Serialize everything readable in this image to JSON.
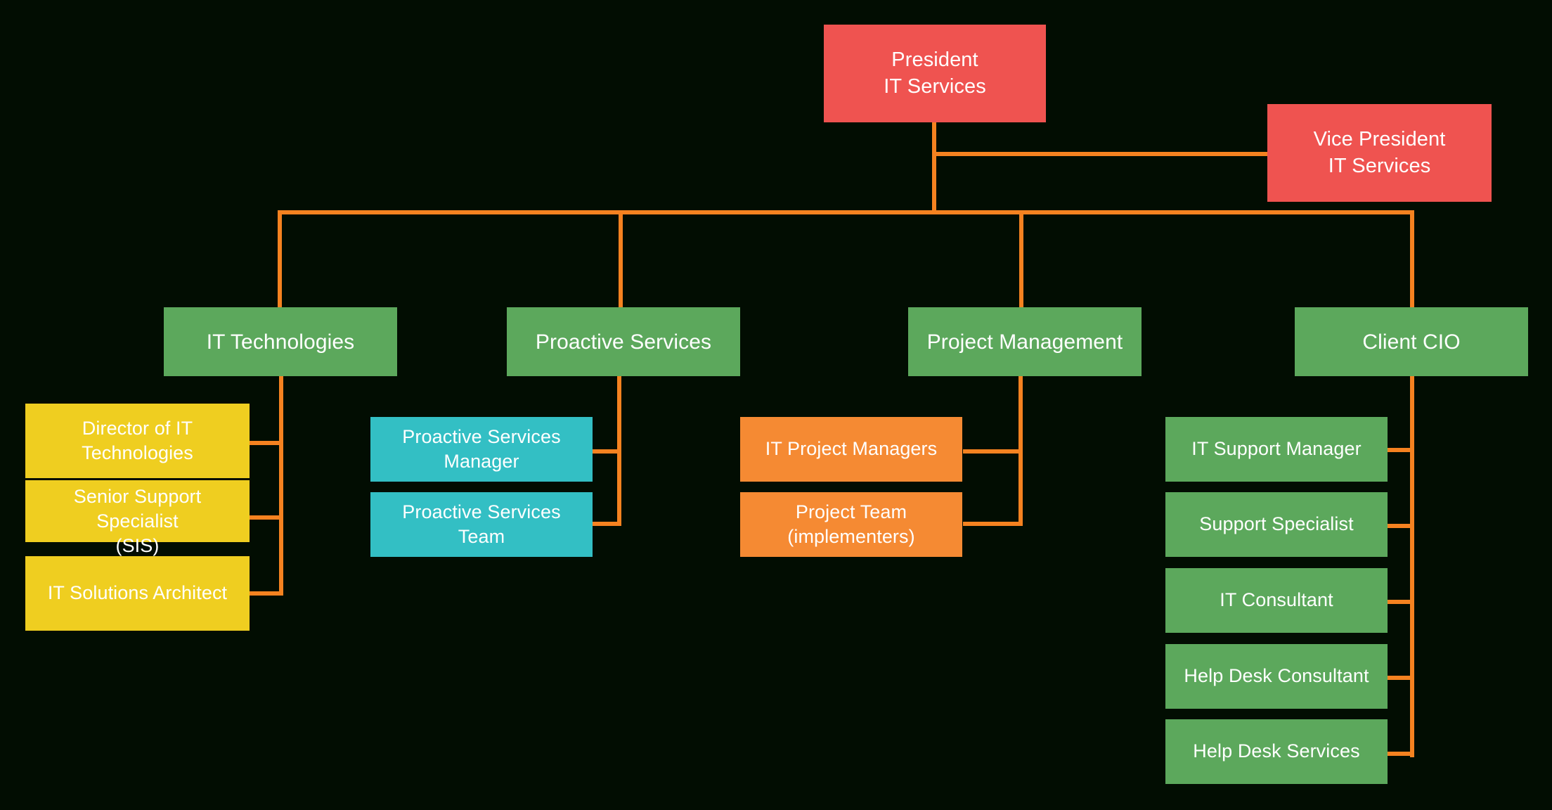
{
  "diagram": {
    "title": "IT Services Organizational Chart",
    "background_color": "#020d02",
    "connector_color": "#F58220",
    "palette": {
      "executive_red": "#EF5350",
      "division_green": "#5CA85C",
      "it_tech_yellow": "#EFCE20",
      "proactive_teal": "#33BFC4",
      "project_orange": "#F58A33"
    }
  },
  "nodes": {
    "president": {
      "label": "President\nIT Services",
      "color": "#EF5350",
      "level": "executive"
    },
    "vice_president": {
      "label": "Vice President\nIT Services",
      "color": "#EF5350",
      "level": "executive"
    },
    "divisions": [
      {
        "label": "IT Technologies",
        "color": "#5CA85C"
      },
      {
        "label": "Proactive Services",
        "color": "#5CA85C"
      },
      {
        "label": "Project Management",
        "color": "#5CA85C"
      },
      {
        "label": "Client CIO",
        "color": "#5CA85C"
      }
    ],
    "it_technologies_children": [
      {
        "label": "Director of IT\nTechnologies",
        "color": "#EFCE20"
      },
      {
        "label": "Senior Support\nSpecialist\n(SIS)",
        "color": "#EFCE20"
      },
      {
        "label": "IT Solutions Architect",
        "color": "#EFCE20"
      }
    ],
    "proactive_services_children": [
      {
        "label": "Proactive Services\nManager",
        "color": "#33BFC4"
      },
      {
        "label": "Proactive Services\nTeam",
        "color": "#33BFC4"
      }
    ],
    "project_management_children": [
      {
        "label": "IT Project Managers",
        "color": "#F58A33"
      },
      {
        "label": "Project Team\n(implementers)",
        "color": "#F58A33"
      }
    ],
    "client_cio_children": [
      {
        "label": "IT Support Manager",
        "color": "#5CA85C"
      },
      {
        "label": "Support Specialist",
        "color": "#5CA85C"
      },
      {
        "label": "IT Consultant",
        "color": "#5CA85C"
      },
      {
        "label": "Help Desk Consultant",
        "color": "#5CA85C"
      },
      {
        "label": "Help Desk Services",
        "color": "#5CA85C"
      }
    ]
  }
}
